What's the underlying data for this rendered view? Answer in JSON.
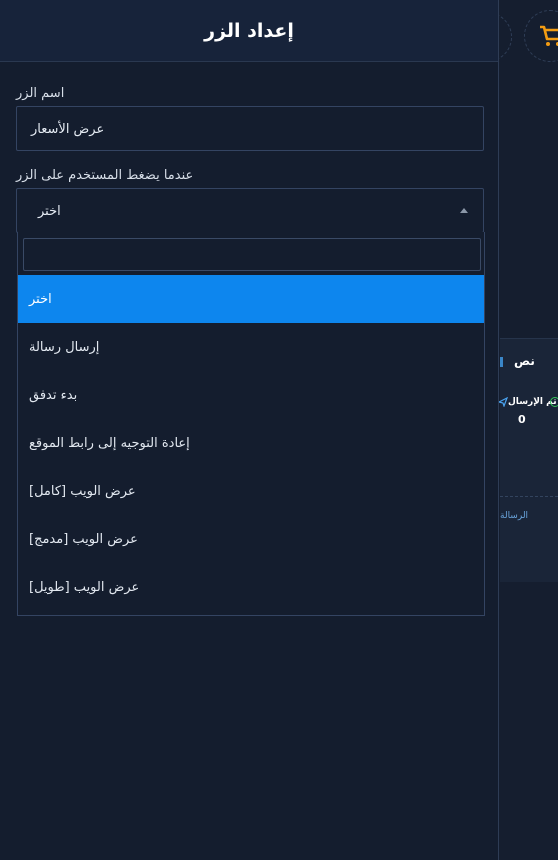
{
  "modal": {
    "title": "إعداد الزر",
    "button_name_label": "اسم الزر",
    "button_name_value": "عرض الأسعار",
    "on_click_label": "عندما يضغط المستخدم على الزر",
    "on_click_selected": "اختر",
    "dropdown": {
      "search_value": "",
      "options": [
        {
          "label": "اختر",
          "selected": true
        },
        {
          "label": "إرسال رسالة",
          "selected": false
        },
        {
          "label": "بدء تدفق",
          "selected": false
        },
        {
          "label": "إعادة التوجيه إلى رابط الموقع",
          "selected": false
        },
        {
          "label": "عرض الويب [كامل]",
          "selected": false
        },
        {
          "label": "عرض الويب [مدمج]",
          "selected": false
        },
        {
          "label": "عرض الويب [طويل]",
          "selected": false
        }
      ]
    }
  },
  "background": {
    "panel_title": "نص",
    "sent_label": "تم الإرسال",
    "sent_count": "0",
    "message_label": "الرسالة"
  },
  "colors": {
    "selected": "#0d86ee",
    "modal_bg": "#141d2e",
    "cart_icon": "#f39c12"
  }
}
